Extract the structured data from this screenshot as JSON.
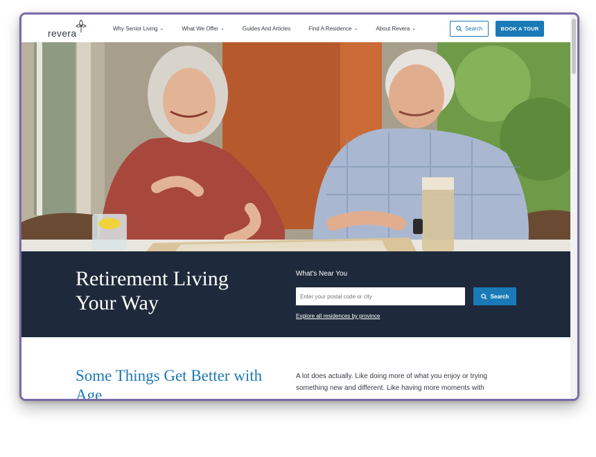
{
  "header": {
    "logo": "revera",
    "nav": [
      {
        "label": "Why Senior Living",
        "has_dropdown": true
      },
      {
        "label": "What We Offer",
        "has_dropdown": true
      },
      {
        "label": "Guides And Articles",
        "has_dropdown": false
      },
      {
        "label": "Find A Residence",
        "has_dropdown": true
      },
      {
        "label": "About Revera",
        "has_dropdown": true
      }
    ],
    "search_label": "Search",
    "tour_label": "BOOK A TOUR"
  },
  "hero": {
    "title": "Retirement Living Your Way",
    "near_label": "What's Near You",
    "input_placeholder": "Enter your postal code or city",
    "search_label": "Search",
    "explore_link": "Explore all residences by province"
  },
  "intro": {
    "title": "Some Things Get Better with Age",
    "body": "A lot does actually. Like doing more of what you enjoy or trying something new and different. Like having more moments with"
  },
  "colors": {
    "brand_blue": "#1a7ab8",
    "band_navy": "#1e2a3b",
    "heading_blue": "#1c78b4",
    "window_frame": "#7a6aa8"
  }
}
